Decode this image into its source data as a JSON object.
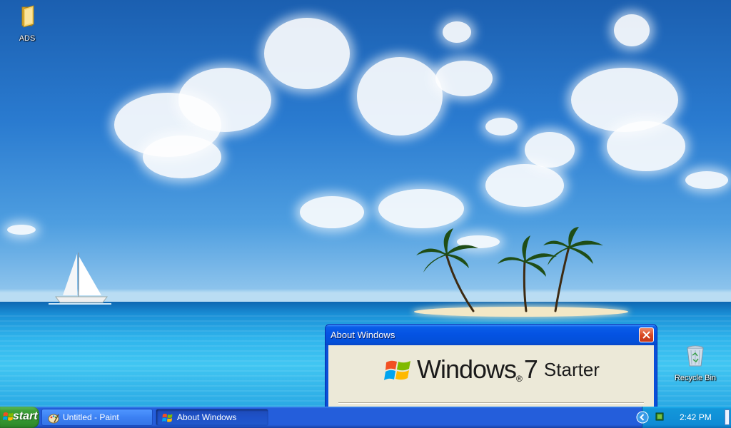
{
  "desktop": {
    "icons": [
      {
        "label": "ADS",
        "icon": "folder-icon"
      },
      {
        "label": "Recycle Bin",
        "icon": "recycle-bin-icon"
      }
    ]
  },
  "dialog": {
    "title": "About Windows",
    "brand": "Windows",
    "trademark": "®",
    "version": "7",
    "edition": "Starter"
  },
  "taskbar": {
    "start_label": "start",
    "tasks": [
      {
        "label": "Untitled - Paint",
        "icon": "paint-icon",
        "active": false
      },
      {
        "label": "About Windows",
        "icon": "windows-flag-icon",
        "active": true
      }
    ],
    "clock": "2:42 PM"
  },
  "colors": {
    "taskbar_blue": "#245edb",
    "start_green": "#3c9f38",
    "tray_blue": "#0f8bd5",
    "titlebar_blue": "#0553e3",
    "close_red": "#d8451e",
    "dialog_face": "#ece9d8"
  }
}
